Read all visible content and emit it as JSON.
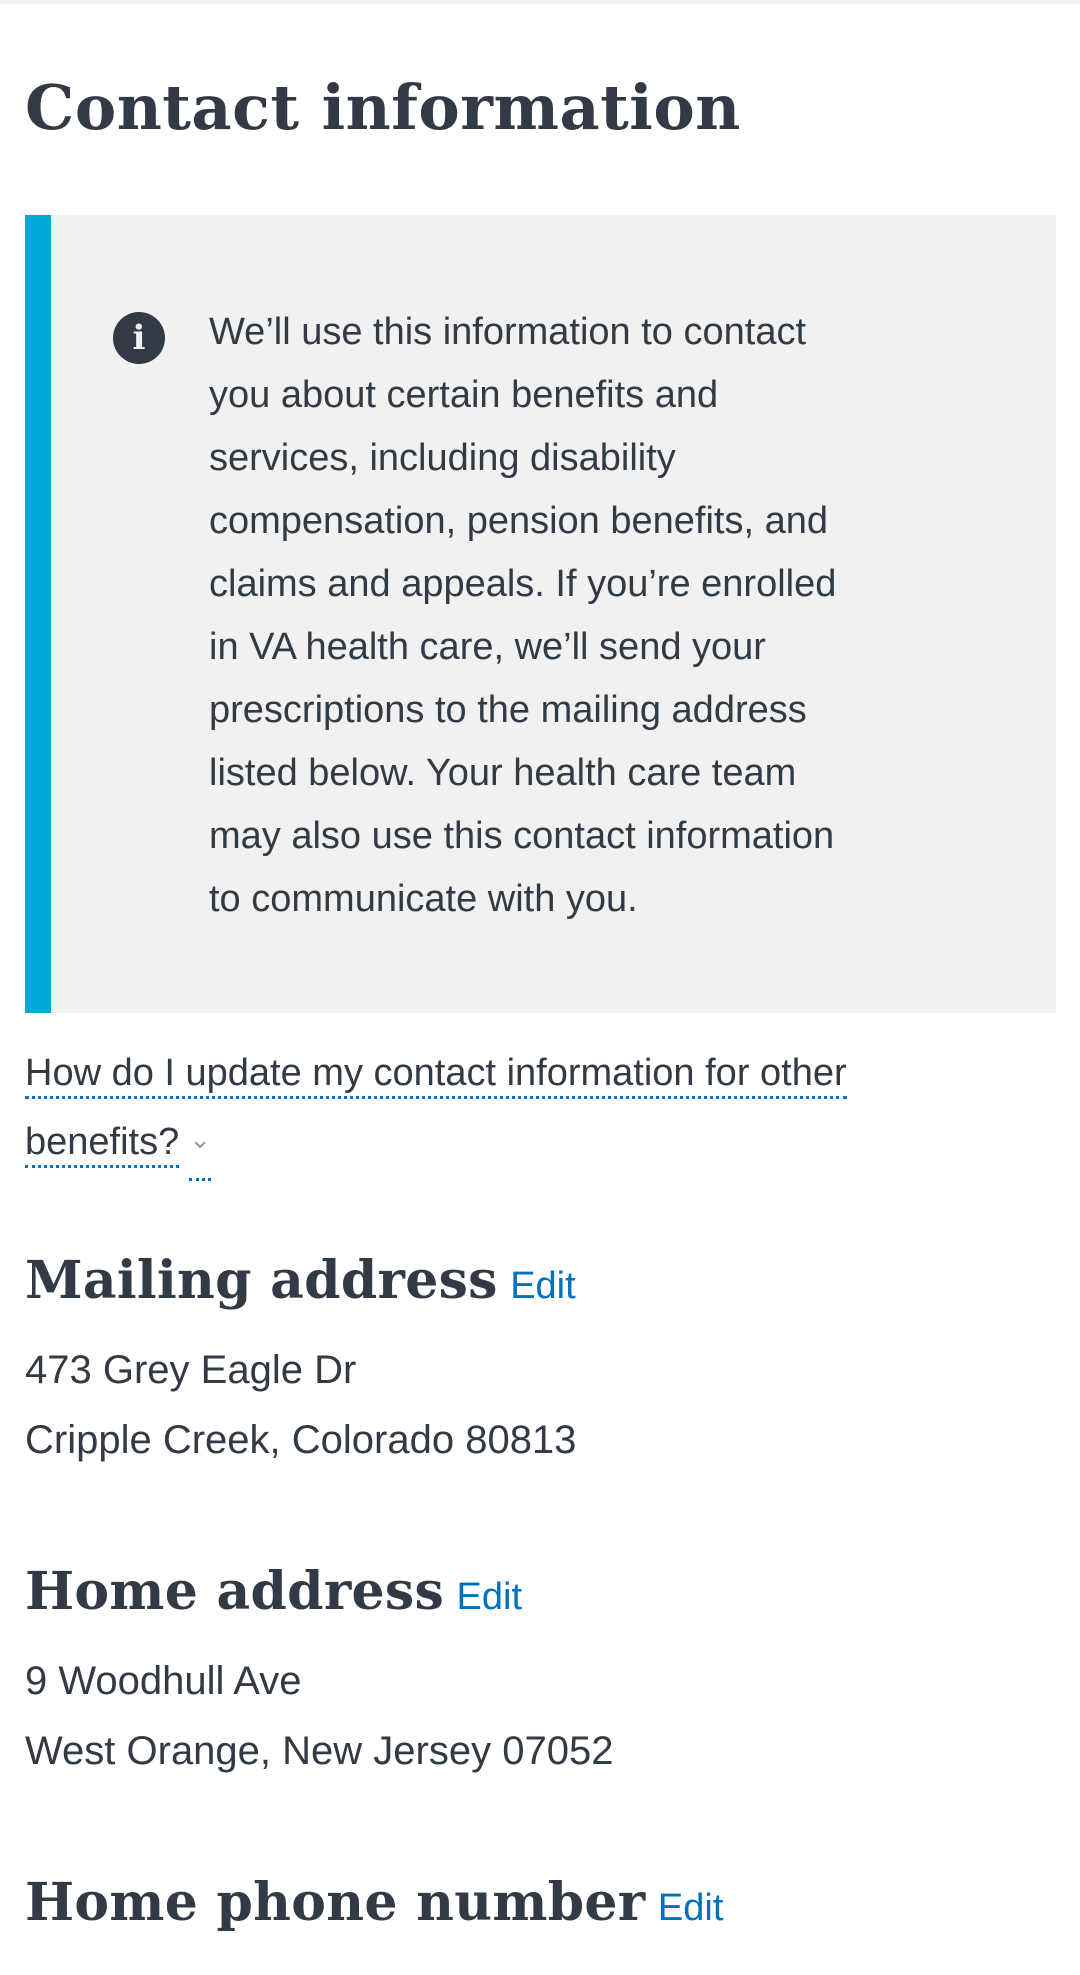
{
  "page": {
    "title": "Contact information"
  },
  "alert": {
    "icon": "info-icon",
    "text_lines": [
      "We’ll use this information to contact",
      "you about certain benefits and",
      "services, including disability",
      "compensation, pension benefits, and",
      "claims and appeals. If you’re enrolled",
      "in VA health care, we’ll send your",
      "prescriptions to the mailing address",
      "listed below. Your health care team",
      "may also use this contact information",
      "to communicate with you."
    ]
  },
  "expander": {
    "line1": "How do I update my contact information for other",
    "line2": "benefits?",
    "icon": "chevron-down-icon"
  },
  "sections": {
    "mailing": {
      "heading": "Mailing address",
      "edit_label": "Edit",
      "line1": "473 Grey Eagle Dr",
      "line2": "Cripple Creek, Colorado 80813"
    },
    "home": {
      "heading": "Home address",
      "edit_label": "Edit",
      "line1": "9 Woodhull Ave",
      "line2": "West Orange, New Jersey 07052"
    },
    "phone": {
      "heading": "Home phone number",
      "edit_label": "Edit"
    }
  },
  "colors": {
    "accent": "#02a8d6",
    "link": "#0071bb",
    "text": "#323a45",
    "alert_bg": "#f1f1f1"
  }
}
